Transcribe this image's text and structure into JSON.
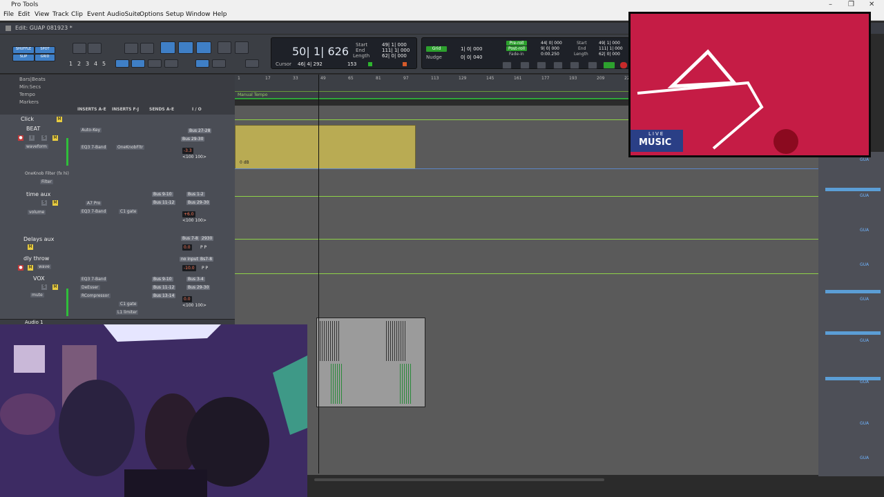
{
  "window": {
    "app_title": "Pro Tools",
    "edit_title": "Edit: GUAP 081923 *"
  },
  "menu": [
    "File",
    "Edit",
    "View",
    "Track",
    "Clip",
    "Event",
    "AudioSuite",
    "Options",
    "Setup",
    "Window",
    "Help"
  ],
  "toolbar": {
    "modes": {
      "shuffle": "SHUFFLE",
      "spot": "SPOT",
      "slip": "SLIP",
      "grid": "GRID"
    },
    "numbers": [
      "1",
      "2",
      "3",
      "4",
      "5"
    ],
    "cursor_label": "Cursor",
    "main_counter": "50| 1| 626",
    "cursor_value": "46| 4| 292",
    "counter_start_label": "Start",
    "counter_end_label": "End",
    "counter_length_label": "Length",
    "start_value": "49| 1| 000",
    "end_value": "111| 1| 000",
    "length_value": "62| 0| 000",
    "grid_label": "Grid",
    "nudge_label": "Nudge",
    "grid_value": "1| 0| 000",
    "nudge_value": "0| 0| 040",
    "small_value": "153",
    "preroll_label": "Pre-roll",
    "postroll_label": "Post-roll",
    "fadein_label": "Fade-in",
    "preroll_value": "44| 0| 000",
    "postroll_value": "9| 0| 000",
    "fadein_value": "0:00.250",
    "start2_value": "49| 1| 000",
    "end2_value": "111| 1| 000",
    "length2_value": "62| 0| 000"
  },
  "rulers": {
    "labels": [
      "Bars|Beats",
      "Min:Secs",
      "Tempo",
      "Markers"
    ],
    "bar_ticks": [
      "1",
      "17",
      "33",
      "49",
      "65",
      "81",
      "97",
      "113",
      "129",
      "145",
      "161",
      "177",
      "193",
      "209",
      "22"
    ],
    "tempo_label": "Manual Tempo"
  },
  "mix_header": {
    "inserts_ae": "INSERTS A-E",
    "inserts_fj": "INSERTS F-J",
    "sends_ae": "SENDS A-E",
    "io": "I / O"
  },
  "tracks": [
    {
      "name": "Click",
      "inserts": [],
      "io": []
    },
    {
      "name": "BEAT",
      "inserts": [
        "Auto-Key",
        "EQ3 7-Band",
        "OneKnobFltr"
      ],
      "io": [
        "Bus 29-30",
        "Bus 27-28"
      ],
      "vol": "-3.3",
      "pan": "<100  100>",
      "mode": "waveform",
      "extra": "OneKnob Filter (fx hi)",
      "filter": "Filter"
    },
    {
      "name": "time aux",
      "inserts": [
        "A7 Pro",
        "EQ3 7-Band",
        "C1 gate"
      ],
      "io": [
        "Bus 9-10",
        "Bus 1-2",
        "Bus 11-12",
        "Bus 29-30"
      ],
      "vol": "+6.0",
      "pan": "<100  100>",
      "mode": "volume"
    },
    {
      "name": "Delays aux",
      "inserts": [],
      "io": [
        "Bus 7-8",
        "2930"
      ],
      "vol": "0.0",
      "pan": "P  P"
    },
    {
      "name": "dly throw",
      "inserts": [],
      "io": [
        "no input",
        "Bs7-8"
      ],
      "vol": "-10.0",
      "pan": "P  P",
      "mode": "wave"
    },
    {
      "name": "VOX",
      "inserts": [
        "EQ3 7-Band",
        "DeEsser",
        "RCompressor",
        "C1 gate",
        "L1 limiter"
      ],
      "io": [
        "Bus 9-10",
        "Bus 3-4",
        "Bus 11-12",
        "Bus 29-30",
        "Bus 13-14"
      ],
      "vol": "0.0",
      "pan": "<100  100>",
      "mode": "mute"
    },
    {
      "name": "Audio 1",
      "inserts": [],
      "io": []
    }
  ],
  "edit_area": {
    "clip_label": "0 dB"
  },
  "right_pane": {
    "item": "GUA"
  },
  "live_music": {
    "line1": "LIVE",
    "line2": "MUSIC"
  }
}
